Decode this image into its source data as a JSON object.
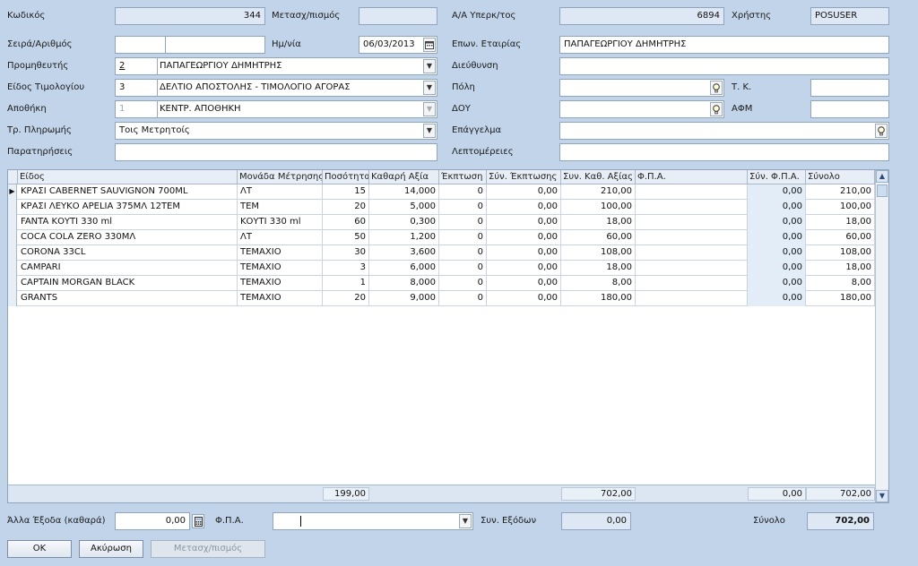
{
  "header": {
    "code_label": "Κωδικός",
    "code_value": "344",
    "transfer_label": "Μετασχ/πισμός",
    "transfer_value": "",
    "aa_label": "Α/Α Υπερκ/τος",
    "aa_value": "6894",
    "user_label": "Χρήστης",
    "user_value": "POSUSER"
  },
  "form": {
    "series_label": "Σειρά/Αριθμός",
    "series_value": "",
    "number_value": "",
    "date_label": "Ημ/νία",
    "date_value": "06/03/2013",
    "company_label": "Επων. Εταιρίας",
    "company_value": "ΠΑΠΑΓΕΩΡΓΙΟΥ ΔΗΜΗΤΡΗΣ",
    "supplier_label": "Προμηθευτής",
    "supplier_code": "2",
    "supplier_value": "ΠΑΠΑΓΕΩΡΓΙΟΥ ΔΗΜΗΤΡΗΣ",
    "address_label": "Διεύθυνση",
    "address_value": "",
    "invoice_type_label": "Είδος Τιμολογίου",
    "invoice_type_code": "3",
    "invoice_type_value": "ΔΕΛΤΙΟ ΑΠΟΣΤΟΛΗΣ - ΤΙΜΟΛΟΓΙΟ ΑΓΟΡΑΣ",
    "city_label": "Πόλη",
    "city_value": "",
    "tk_label": "Τ. Κ.",
    "tk_value": "",
    "warehouse_label": "Αποθήκη",
    "warehouse_code": "1",
    "warehouse_value": "ΚΕΝΤΡ. ΑΠΟΘΗΚΗ",
    "doy_label": "ΔΟΥ",
    "doy_value": "",
    "afm_label": "ΑΦΜ",
    "afm_value": "",
    "payment_label": "Τρ. Πληρωμής",
    "payment_value": "Τοις Μετρητοίς",
    "profession_label": "Επάγγελμα",
    "profession_value": "",
    "notes_label": "Παρατηρήσεις",
    "notes_value": "",
    "details_label": "Λεπτομέρειες",
    "details_value": ""
  },
  "grid": {
    "columns": [
      "Είδος",
      "Μονάδα Μέτρησης",
      "Ποσότητα",
      "Καθαρή Αξία",
      "Έκπτωση",
      "Σύν. Έκπτωσης",
      "Συν. Καθ. Αξίας",
      "Φ.Π.Α.",
      "Σύν. Φ.Π.Α.",
      "Σύνολο"
    ],
    "rows": [
      [
        "ΚΡΑΣΙ CABERNET SAUVIGNON 700ML",
        "ΛΤ",
        "15",
        "14,000",
        "0",
        "0,00",
        "210,00",
        "",
        "0,00",
        "210,00"
      ],
      [
        "ΚΡΑΣΙ ΛΕΥΚΟ APELIA 375ΜΛ 12ΤΕΜ",
        "ΤΕΜ",
        "20",
        "5,000",
        "0",
        "0,00",
        "100,00",
        "",
        "0,00",
        "100,00"
      ],
      [
        "FANTA ΚΟΥΤΙ 330 ml",
        "ΚΟΥΤΙ 330 ml",
        "60",
        "0,300",
        "0",
        "0,00",
        "18,00",
        "",
        "0,00",
        "18,00"
      ],
      [
        "COCA COLA ZERO 330ΜΛ",
        "ΛΤ",
        "50",
        "1,200",
        "0",
        "0,00",
        "60,00",
        "",
        "0,00",
        "60,00"
      ],
      [
        "CORONA 33CL",
        "ΤΕΜΑΧΙΟ",
        "30",
        "3,600",
        "0",
        "0,00",
        "108,00",
        "",
        "0,00",
        "108,00"
      ],
      [
        "CAMPARI",
        "ΤΕΜΑΧΙΟ",
        "3",
        "6,000",
        "0",
        "0,00",
        "18,00",
        "",
        "0,00",
        "18,00"
      ],
      [
        "CAPTAIN MORGAN BLACK",
        "ΤΕΜΑΧΙΟ",
        "1",
        "8,000",
        "0",
        "0,00",
        "8,00",
        "",
        "0,00",
        "8,00"
      ],
      [
        "GRANTS",
        "ΤΕΜΑΧΙΟ",
        "20",
        "9,000",
        "0",
        "0,00",
        "180,00",
        "",
        "0,00",
        "180,00"
      ]
    ],
    "footer": {
      "quantity_total": "199,00",
      "net_total": "702,00",
      "vat_total": "0,00",
      "grand_total": "702,00"
    }
  },
  "bottom": {
    "other_expenses_label": "Άλλα Έξοδα (καθαρά)",
    "other_expenses_value": "0,00",
    "vat_label": "Φ.Π.Α.",
    "vat_value": "",
    "sum_expenses_label": "Συν. Εξόδων",
    "sum_expenses_value": "0,00",
    "total_label": "Σύνολο",
    "total_value": "702,00"
  },
  "buttons": {
    "ok": "OK",
    "cancel": "Ακύρωση",
    "transform": "Μετασχ/πισμός"
  },
  "icons": {
    "combo_arrow": "▼",
    "row_pointer": "▶",
    "lookup": "bulb-icon",
    "calendar": "calendar-icon",
    "calculator": "calculator-icon"
  }
}
